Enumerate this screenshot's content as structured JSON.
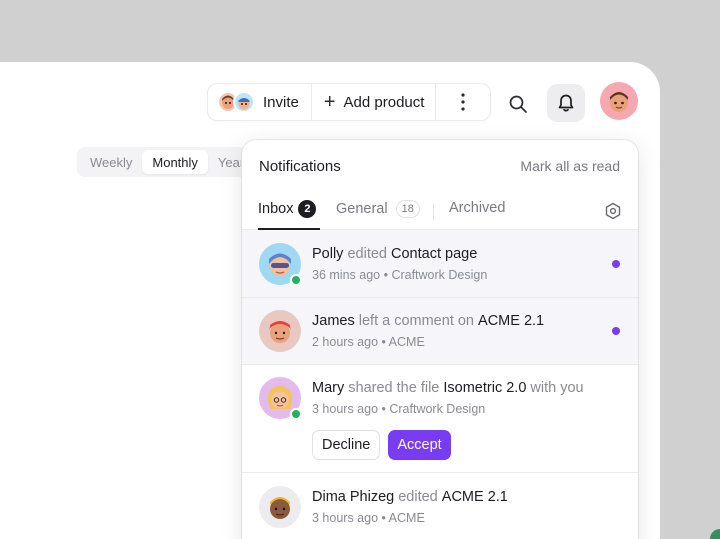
{
  "toolbar": {
    "invite_label": "Invite",
    "add_product_label": "Add product"
  },
  "segmented": {
    "items": [
      "Weekly",
      "Monthly",
      "Yearly"
    ],
    "active": "Monthly"
  },
  "notifications": {
    "title": "Notifications",
    "mark_all_read": "Mark all as read",
    "tabs": [
      {
        "label": "Inbox",
        "count": "2"
      },
      {
        "label": "General",
        "count": "18"
      },
      {
        "label": "Archived"
      }
    ],
    "items": [
      {
        "user": "Polly",
        "action": "edited",
        "target": "Contact page",
        "suffix": "",
        "time": "36 mins ago",
        "source": "Craftwork Design",
        "unread": true,
        "online": true
      },
      {
        "user": "James",
        "action": "left a comment on",
        "target": "ACME 2.1",
        "suffix": "",
        "time": "2 hours ago",
        "source": "ACME",
        "unread": true,
        "online": false
      },
      {
        "user": "Mary",
        "action": "shared the file",
        "target": "Isometric 2.0",
        "suffix": "with you",
        "time": "3 hours ago",
        "source": "Craftwork Design",
        "unread": false,
        "online": true
      },
      {
        "user": "Dima Phizeg",
        "action": "edited",
        "target": "ACME 2.1",
        "suffix": "",
        "time": "3 hours ago",
        "source": "ACME",
        "unread": false,
        "online": false
      }
    ],
    "decline_label": "Decline",
    "accept_label": "Accept"
  },
  "colors": {
    "accent": "#7a3cf0",
    "online": "#22b45a",
    "background": "#cfd0cf"
  }
}
